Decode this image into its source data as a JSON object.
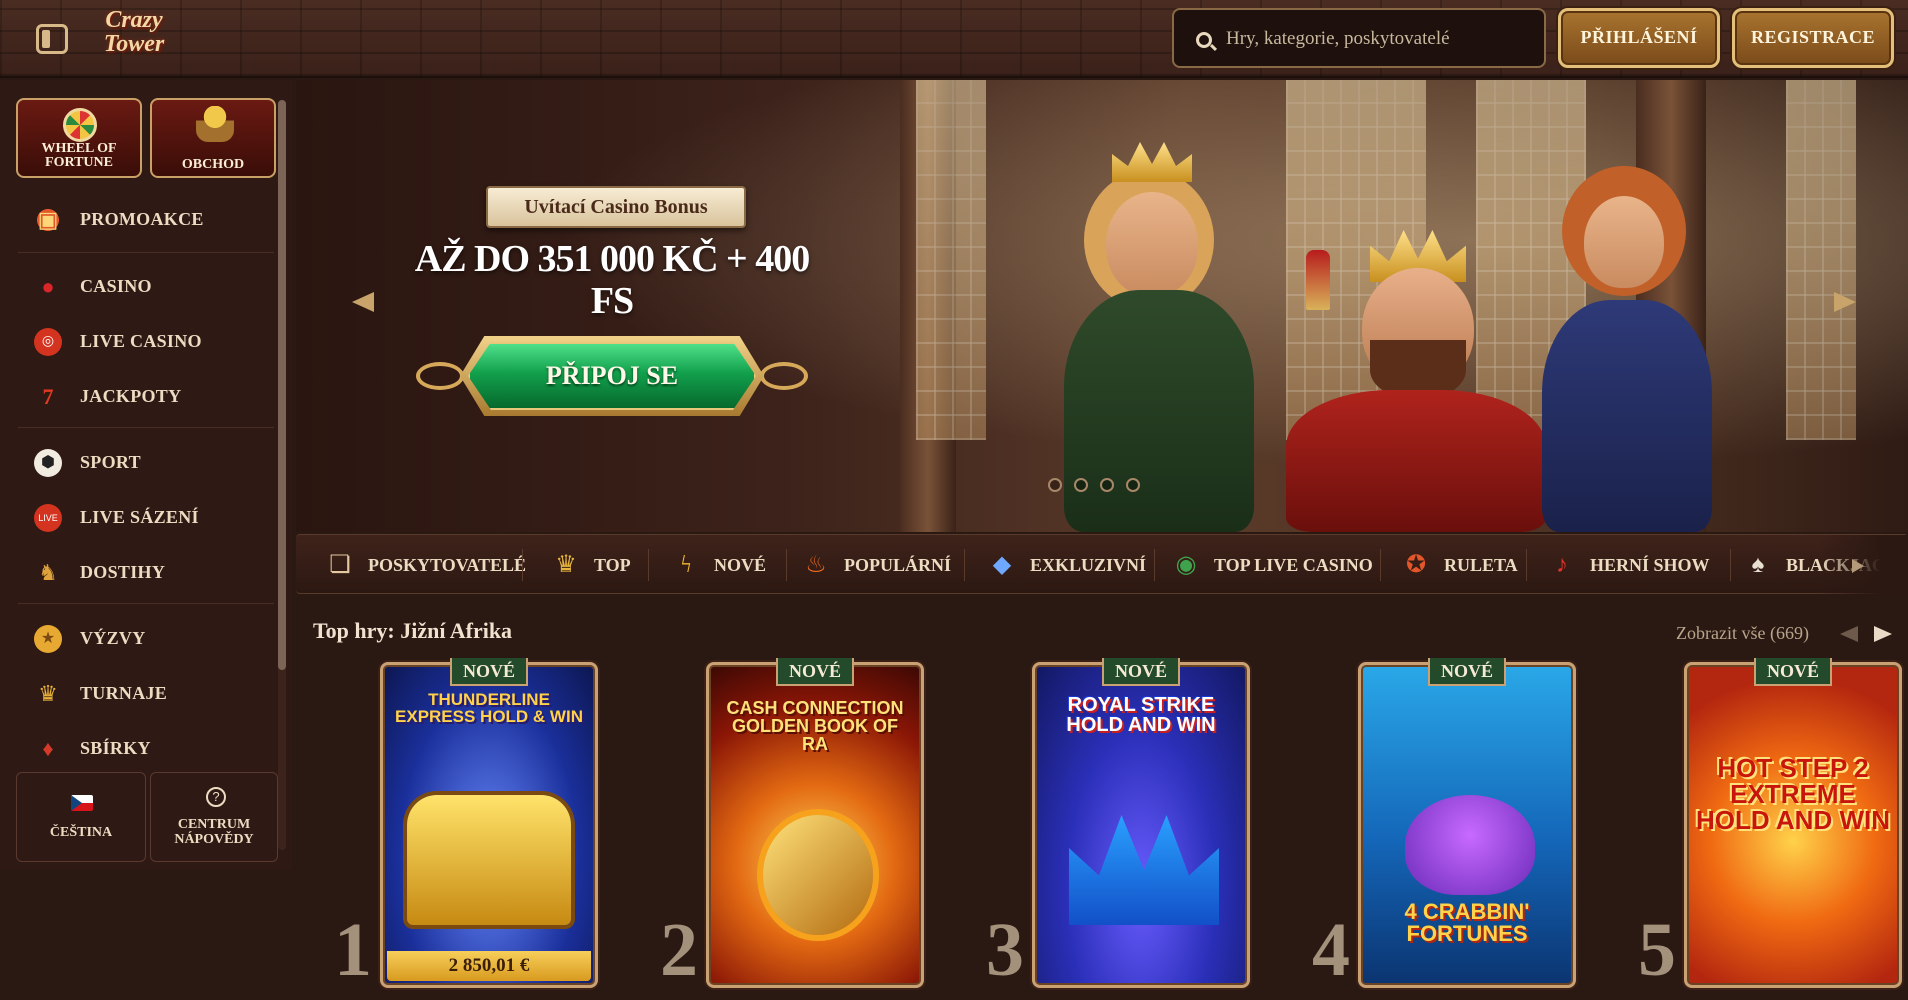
{
  "header": {
    "logo_text": "Crazy Tower",
    "search_placeholder": "Hry, kategorie, poskytovatelé",
    "login_label": "PŘIHLÁŠENÍ",
    "register_label": "REGISTRACE"
  },
  "sidebar": {
    "features": [
      {
        "label": "WHEEL OF FORTUNE",
        "icon": "wheel-of-fortune-icon"
      },
      {
        "label": "OBCHOD",
        "icon": "shop-basket-icon"
      }
    ],
    "items": [
      {
        "label": "PROMOAKCE",
        "icon": "gift-icon"
      },
      {
        "label": "CASINO",
        "icon": "cherries-icon"
      },
      {
        "label": "LIVE CASINO",
        "icon": "roulette-chip-icon"
      },
      {
        "label": "JACKPOTY",
        "icon": "lucky-seven-icon"
      },
      {
        "label": "SPORT",
        "icon": "soccer-ball-icon"
      },
      {
        "label": "LIVE SÁZENÍ",
        "icon": "live-badge-icon"
      },
      {
        "label": "DOSTIHY",
        "icon": "horse-head-icon"
      },
      {
        "label": "VÝZVY",
        "icon": "medal-icon"
      },
      {
        "label": "TURNAJE",
        "icon": "trophy-icon"
      },
      {
        "label": "SBÍRKY",
        "icon": "cards-collection-icon"
      }
    ],
    "language_label": "ČEŠTINA",
    "help_label": "CENTRUM NÁPOVĚDY"
  },
  "hero": {
    "bonus_title": "Uvítací Casino Bonus",
    "bonus_amount": "AŽ DO 351 000 KČ + 400 FS",
    "cta_label": "PŘIPOJ SE"
  },
  "categories": [
    {
      "label": "POSKYTOVATELÉ",
      "icon": "scroll-icon"
    },
    {
      "label": "TOP",
      "icon": "crown-icon"
    },
    {
      "label": "NOVÉ",
      "icon": "lightning-icon"
    },
    {
      "label": "POPULÁRNÍ",
      "icon": "flame-icon"
    },
    {
      "label": "EXKLUZIVNÍ",
      "icon": "diamond-icon"
    },
    {
      "label": "TOP LIVE CASINO",
      "icon": "poker-chip-icon"
    },
    {
      "label": "RULETA",
      "icon": "roulette-icon"
    },
    {
      "label": "HERNÍ SHOW",
      "icon": "microphone-icon"
    },
    {
      "label": "BLACKJACK",
      "icon": "playing-cards-icon"
    }
  ],
  "top_games": {
    "title": "Top hry: Jižní Afrika",
    "show_all": "Zobrazit vše (669)",
    "games": [
      {
        "rank": "1",
        "badge": "NOVÉ",
        "name": "THUNDERLINE EXPRESS HOLD & WIN",
        "price": "2 850,01 €",
        "accent": "#2a5bd6"
      },
      {
        "rank": "2",
        "badge": "NOVÉ",
        "name": "CASH CONNECTION GOLDEN BOOK OF RA",
        "price": "",
        "accent": "#b3260f"
      },
      {
        "rank": "3",
        "badge": "NOVÉ",
        "name": "ROYAL STRIKE HOLD AND WIN",
        "price": "",
        "accent": "#2a3fb8"
      },
      {
        "rank": "4",
        "badge": "NOVÉ",
        "name": "4 CRABBIN' FORTUNES",
        "price": "",
        "accent": "#1b7fc4"
      },
      {
        "rank": "5",
        "badge": "NOVÉ",
        "name": "HOT STEP 2 EXTREME HOLD AND WIN",
        "price": "",
        "accent": "#d9480f"
      }
    ]
  }
}
